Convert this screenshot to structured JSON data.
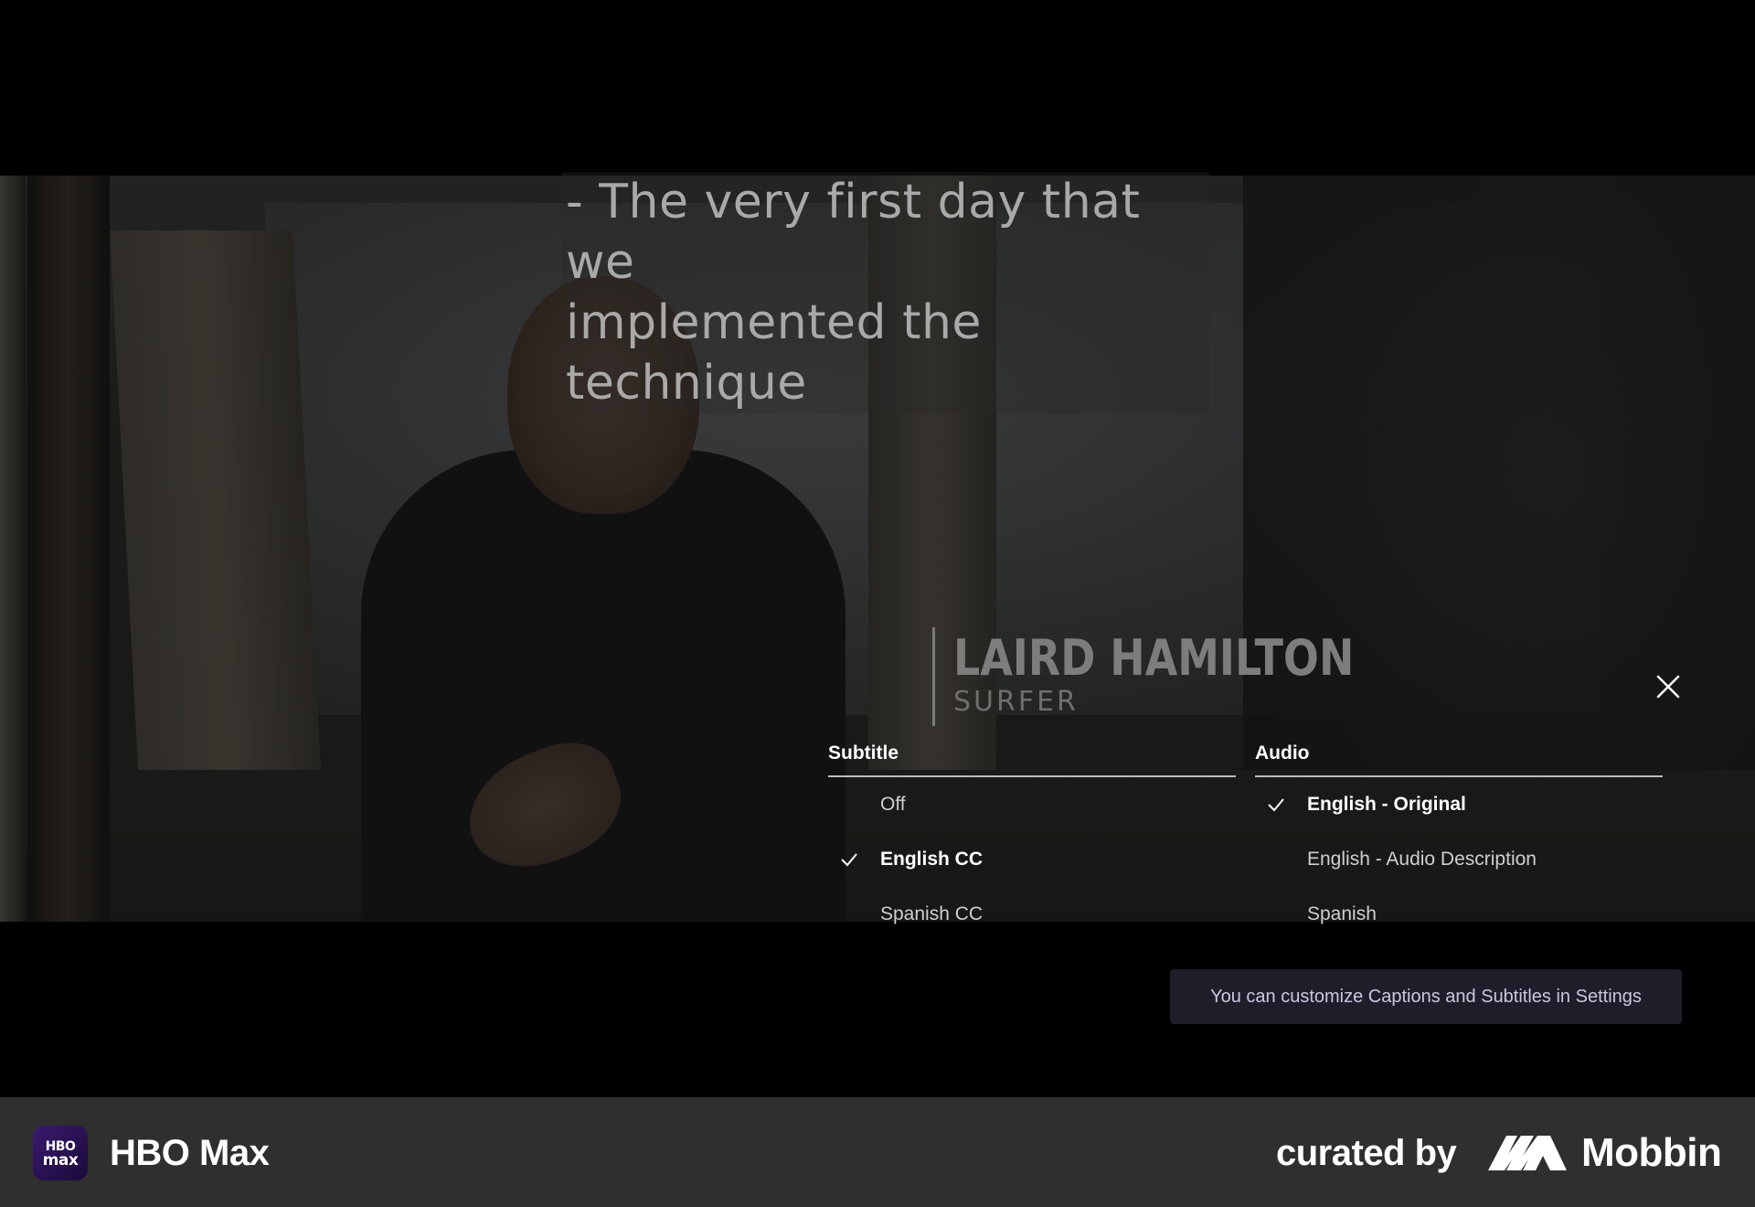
{
  "player": {
    "burned_subtitle_line1": "-  The very first day that we",
    "burned_subtitle_line2": "implemented the technique",
    "lower_third_name": "LAIRD HAMILTON",
    "lower_third_role": "SURFER",
    "close_icon": "close-icon"
  },
  "menu": {
    "subtitle": {
      "heading": "Subtitle",
      "items": [
        {
          "label": "Off",
          "selected": false
        },
        {
          "label": "English CC",
          "selected": true
        },
        {
          "label": "Spanish CC",
          "selected": false
        }
      ]
    },
    "audio": {
      "heading": "Audio",
      "items": [
        {
          "label": "English - Original",
          "selected": true
        },
        {
          "label": "English - Audio Description",
          "selected": false
        },
        {
          "label": "Spanish",
          "selected": false
        }
      ]
    },
    "hint": "You can customize Captions and Subtitles in Settings"
  },
  "footer": {
    "app_logo_line1": "HBO",
    "app_logo_line2": "max",
    "app_name": "HBO Max",
    "curated_by": "curated by",
    "brand_name": "Mobbin"
  },
  "colors": {
    "accent": "#ffffff",
    "hint_bg": "#1e1e2a",
    "footer_bg": "#2f2f2f",
    "logo_bg": "#3a1a6e"
  }
}
